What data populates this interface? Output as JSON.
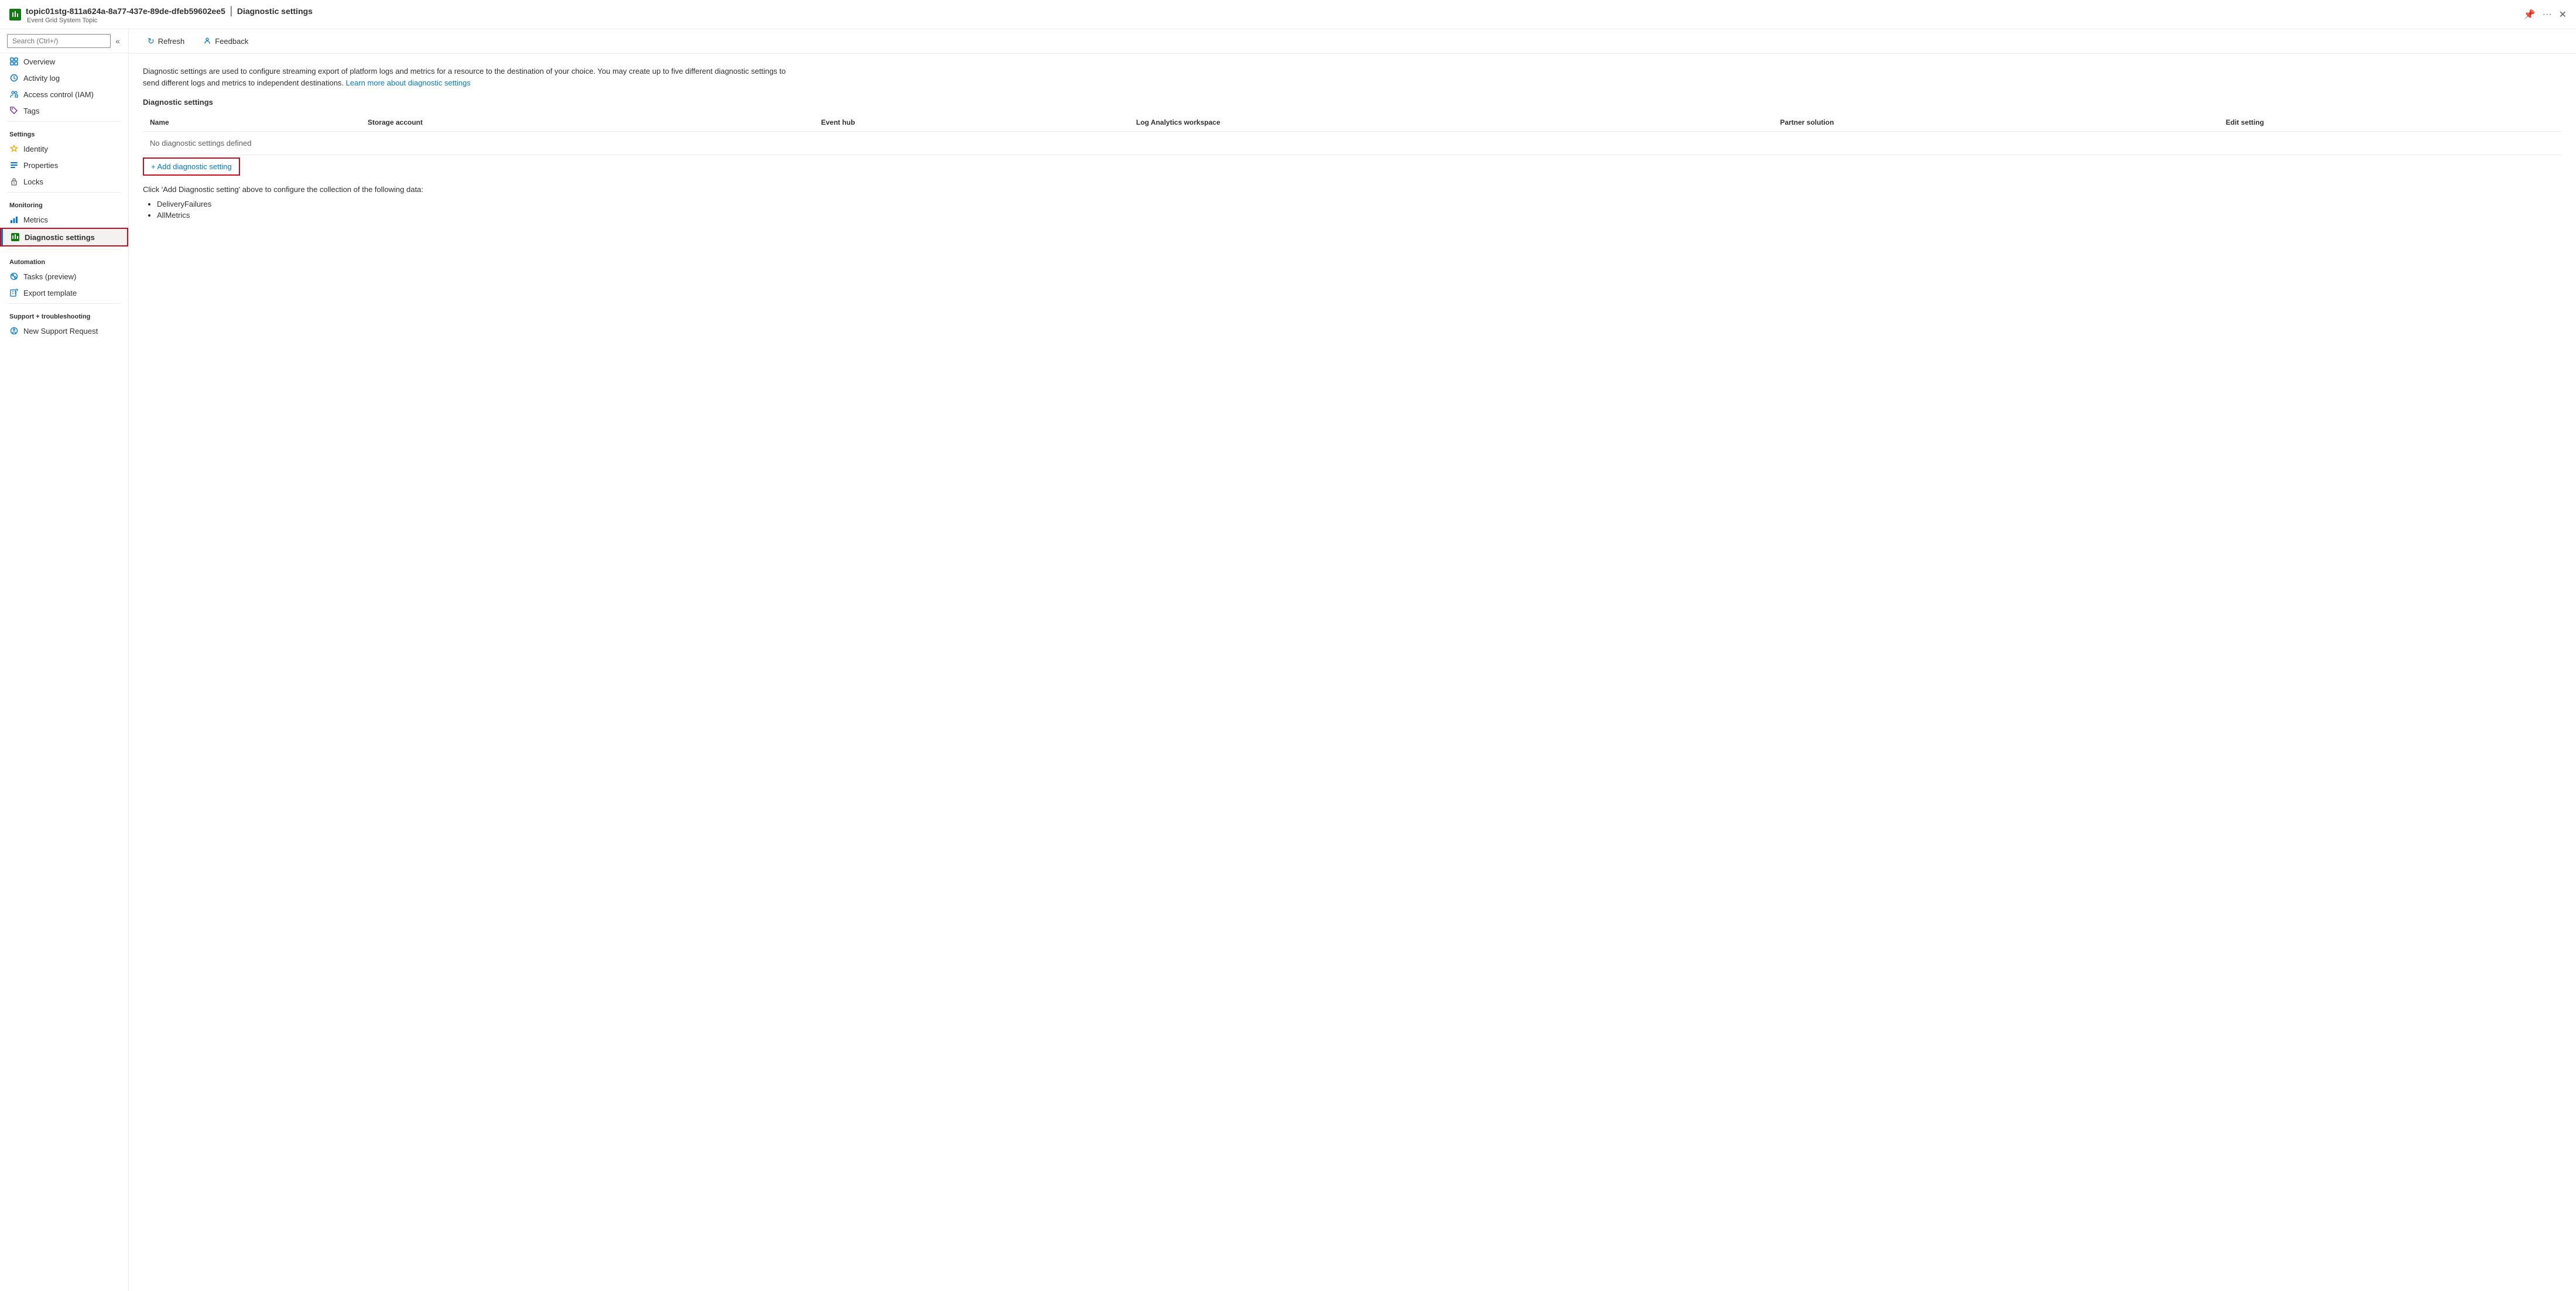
{
  "titleBar": {
    "icon": "EG",
    "resourceName": "topic01stg-811a624a-8a77-437e-89de-dfeb59602ee5",
    "separator": "|",
    "pageTitle": "Diagnostic settings",
    "resourceType": "Event Grid System Topic",
    "pinLabel": "📌",
    "moreLabel": "···",
    "closeLabel": "✕"
  },
  "toolbar": {
    "refreshLabel": "Refresh",
    "feedbackLabel": "Feedback"
  },
  "description": {
    "text1": "Diagnostic settings are used to configure streaming export of platform logs and metrics for a resource to the destination of your choice. You may create up to five different diagnostic settings to send different logs and metrics to independent destinations. ",
    "linkText": "Learn more about diagnostic settings",
    "sectionLabel": "Diagnostic settings"
  },
  "table": {
    "columns": [
      "Name",
      "Storage account",
      "Event hub",
      "Log Analytics workspace",
      "Partner solution",
      "Edit setting"
    ],
    "emptyMessage": "No diagnostic settings defined"
  },
  "addButton": {
    "label": "+ Add diagnostic setting"
  },
  "infoSection": {
    "text": "Click 'Add Diagnostic setting' above to configure the collection of the following data:",
    "items": [
      "DeliveryFailures",
      "AllMetrics"
    ]
  },
  "sidebar": {
    "searchPlaceholder": "Search (Ctrl+/)",
    "items": [
      {
        "id": "overview",
        "label": "Overview",
        "icon": "overview",
        "section": null
      },
      {
        "id": "activity-log",
        "label": "Activity log",
        "icon": "activity",
        "section": null
      },
      {
        "id": "access-control",
        "label": "Access control (IAM)",
        "icon": "iam",
        "section": null
      },
      {
        "id": "tags",
        "label": "Tags",
        "icon": "tags",
        "section": null
      },
      {
        "id": "settings",
        "label": "Settings",
        "isSection": true
      },
      {
        "id": "identity",
        "label": "Identity",
        "icon": "identity",
        "section": "Settings"
      },
      {
        "id": "properties",
        "label": "Properties",
        "icon": "properties",
        "section": "Settings"
      },
      {
        "id": "locks",
        "label": "Locks",
        "icon": "locks",
        "section": "Settings"
      },
      {
        "id": "monitoring",
        "label": "Monitoring",
        "isSection": true
      },
      {
        "id": "metrics",
        "label": "Metrics",
        "icon": "metrics",
        "section": "Monitoring"
      },
      {
        "id": "diagnostic-settings",
        "label": "Diagnostic settings",
        "icon": "diag",
        "section": "Monitoring",
        "active": true
      },
      {
        "id": "automation",
        "label": "Automation",
        "isSection": true
      },
      {
        "id": "tasks",
        "label": "Tasks (preview)",
        "icon": "tasks",
        "section": "Automation"
      },
      {
        "id": "export-template",
        "label": "Export template",
        "icon": "export",
        "section": "Automation"
      },
      {
        "id": "support-troubleshooting",
        "label": "Support + troubleshooting",
        "isSection": true
      },
      {
        "id": "new-support-request",
        "label": "New Support Request",
        "icon": "support",
        "section": "Support + troubleshooting"
      }
    ]
  }
}
